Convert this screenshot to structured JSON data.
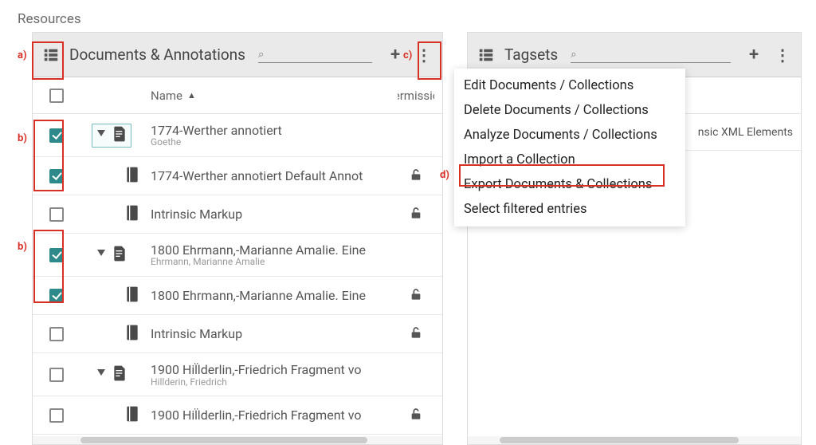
{
  "page_title": "Resources",
  "left_panel": {
    "title": "Documents & Annotations",
    "search_placeholder": "",
    "columns": {
      "name": "Name",
      "permission": "Permission"
    },
    "rows": [
      {
        "kind": "doc",
        "checked": true,
        "expanded": true,
        "selected": true,
        "name": "1774-Werther annotiert",
        "subtitle": "Goethe"
      },
      {
        "kind": "coll",
        "checked": true,
        "name": "1774-Werther annotiert Default Annot",
        "perm": "unlock"
      },
      {
        "kind": "coll",
        "checked": false,
        "name": "Intrinsic Markup",
        "perm": "unlock"
      },
      {
        "kind": "doc",
        "checked": true,
        "expanded": true,
        "name": "1800 Ehrmann,-Marianne Amalie. Eine",
        "subtitle": "Ehrmann, Marianne Amalie"
      },
      {
        "kind": "coll",
        "checked": true,
        "name": "1800 Ehrmann,-Marianne Amalie. Eine",
        "perm": "unlock"
      },
      {
        "kind": "coll",
        "checked": false,
        "name": "Intrinsic Markup",
        "perm": "unlock"
      },
      {
        "kind": "doc",
        "checked": false,
        "expanded": true,
        "name": "1900 Hil̈lderlin,-Friedrich Fragment vo",
        "subtitle": "Hillderin, Friedrich"
      },
      {
        "kind": "coll",
        "checked": false,
        "name": "1900 Hil̈lderlin,-Friedrich Fragment vo",
        "perm": "unlock"
      }
    ]
  },
  "right_panel": {
    "title": "Tagsets",
    "rows": [
      {
        "name": "nsic XML Elements"
      }
    ]
  },
  "menu": {
    "items": [
      "Edit Documents / Collections",
      "Delete Documents / Collections",
      "Analyze Documents / Collections",
      "Import a Collection",
      "Export Documents & Collections",
      "Select filtered entries"
    ],
    "highlighted_index": 4
  },
  "annotations": {
    "a": "a)",
    "b": "b)",
    "c": "c)",
    "d": "d)"
  }
}
